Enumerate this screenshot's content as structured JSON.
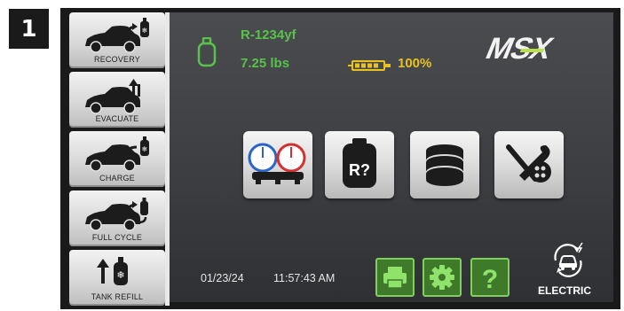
{
  "step_number": "1",
  "sidebar": {
    "items": [
      {
        "label": "RECOVERY",
        "icon": "car-tank-recovery-icon"
      },
      {
        "label": "EVACUATE",
        "icon": "car-up-arrow-icon"
      },
      {
        "label": "CHARGE",
        "icon": "car-tank-charge-icon"
      },
      {
        "label": "FULL CYCLE",
        "icon": "car-full-cycle-icon"
      },
      {
        "label": "TANK REFILL",
        "icon": "tank-refill-icon"
      }
    ]
  },
  "status": {
    "refrigerant_name": "R-1234yf",
    "refrigerant_weight": "7.25 lbs",
    "battery_percent": "100%"
  },
  "brand_logo": "MSX",
  "main_buttons": [
    {
      "name": "gauges",
      "icon": "gauges-icon"
    },
    {
      "name": "refrigerant-identify",
      "icon": "tank-question-icon",
      "label": "R?"
    },
    {
      "name": "database",
      "icon": "database-icon"
    },
    {
      "name": "service",
      "icon": "tools-icon"
    }
  ],
  "footer": {
    "date": "01/23/24",
    "time": "11:57:43 AM",
    "help_label": "?",
    "electric_label": "ELECTRIC"
  },
  "colors": {
    "status_green": "#58c24a",
    "battery_yellow": "#e8c21e",
    "button_green": "#3f7a2a",
    "screen_gray": "#444649"
  }
}
